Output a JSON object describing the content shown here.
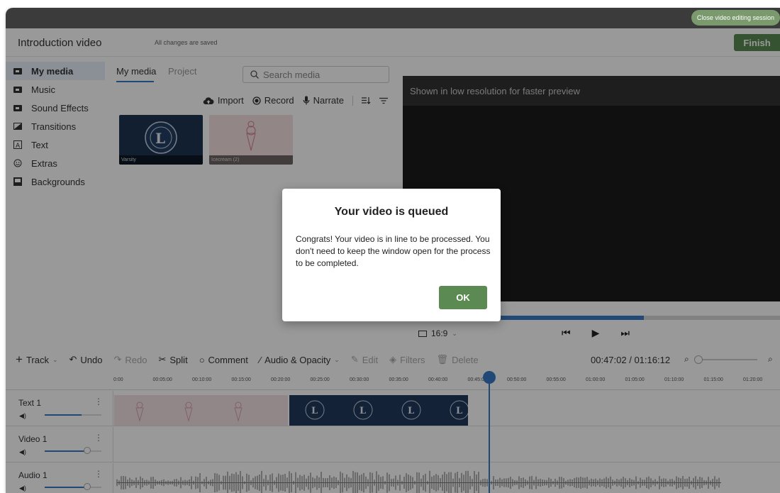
{
  "session": {
    "close_label": "Close video editing session"
  },
  "header": {
    "title": "Introduction video",
    "save_status": "All changes are saved",
    "finish_label": "Finish"
  },
  "sidebar": {
    "items": [
      {
        "label": "My media",
        "icon": "folder-icon"
      },
      {
        "label": "Music",
        "icon": "folder-icon"
      },
      {
        "label": "Sound Effects",
        "icon": "folder-icon"
      },
      {
        "label": "Transitions",
        "icon": "transition-icon"
      },
      {
        "label": "Text",
        "icon": "text-icon"
      },
      {
        "label": "Extras",
        "icon": "smiley-icon"
      },
      {
        "label": "Backgrounds",
        "icon": "background-icon"
      }
    ]
  },
  "media": {
    "tabs": [
      "My media",
      "Project"
    ],
    "search_placeholder": "Search media",
    "toolbar": {
      "import": "Import",
      "record": "Record",
      "narrate": "Narrate"
    },
    "items": [
      {
        "caption": "Varsity"
      },
      {
        "caption": "Icecream (2)"
      }
    ]
  },
  "preview": {
    "note": "Shown in low resolution for faster preview",
    "ratio": "16:9",
    "progress_fraction": 0.64
  },
  "timeline": {
    "toolbar": {
      "track": "Track",
      "undo": "Undo",
      "redo": "Redo",
      "split": "Split",
      "comment": "Comment",
      "audio_opacity": "Audio & Opacity",
      "edit": "Edit",
      "filters": "Filters",
      "delete": "Delete"
    },
    "time_display": "00:47:02 / 01:16:12",
    "ruler": [
      "0:00",
      "00:05:00",
      "00:10:00",
      "00:15:00",
      "00:20:00",
      "00:25:00",
      "00:30:00",
      "00:35:00",
      "00:40:00",
      "00:45:00",
      "00:50:00",
      "00:55:00",
      "01:00:00",
      "01:05:00",
      "01:10:00",
      "01:15:00",
      "01:20:00"
    ],
    "tracks": [
      {
        "name": "Text 1",
        "volume": 0.65
      },
      {
        "name": "Video 1",
        "volume": 0.75
      },
      {
        "name": "Audio 1",
        "volume": 0.75
      }
    ]
  },
  "dialog": {
    "title": "Your video is queued",
    "body": "Congrats! Your video is in line to be processed. You don't need to keep the window open for the process to be completed.",
    "ok_label": "OK"
  },
  "colors": {
    "accent": "#3a78c5",
    "primary_button": "#5b8a52",
    "close_pill": "#7a9a6e"
  }
}
